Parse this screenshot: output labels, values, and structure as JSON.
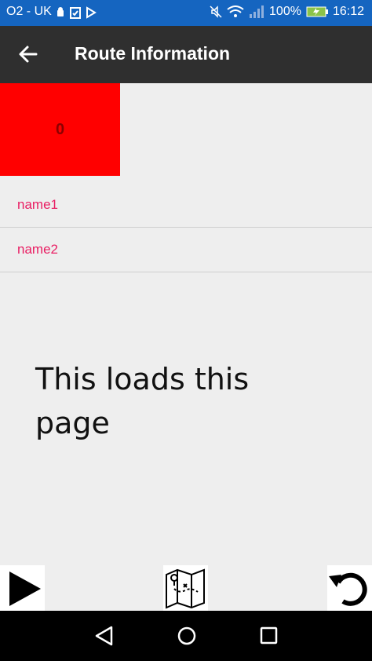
{
  "status_bar": {
    "carrier": "O2 - UK",
    "battery": "100%",
    "time": "16:12"
  },
  "app_bar": {
    "title": "Route Information"
  },
  "counter": {
    "value": "0"
  },
  "list": {
    "items": [
      {
        "label": "name1"
      },
      {
        "label": "name2"
      }
    ]
  },
  "message": {
    "text": "This loads this page"
  },
  "colors": {
    "status_bar": "#1565c0",
    "app_bar": "#2f2f2f",
    "accent": "#e91e63",
    "counter_bg": "#ff0000"
  },
  "icons": {
    "toolbar": [
      "play-icon",
      "map-icon",
      "undo-icon"
    ],
    "nav": [
      "back-triangle-icon",
      "home-circle-icon",
      "recents-square-icon"
    ]
  }
}
